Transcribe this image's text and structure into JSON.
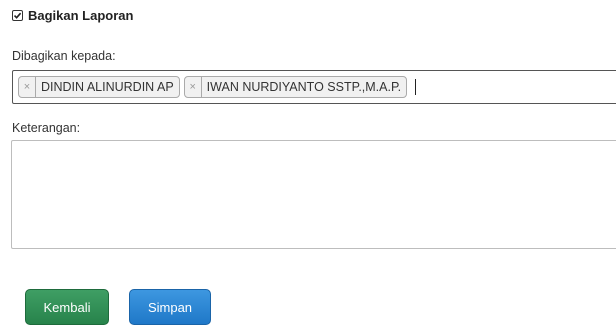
{
  "section": {
    "title": "Bagikan Laporan"
  },
  "shared_with": {
    "label": "Dibagikan kepada:",
    "tags": [
      {
        "remove_glyph": "×",
        "name": "DINDIN ALINURDIN AP"
      },
      {
        "remove_glyph": "×",
        "name": "IWAN NURDIYANTO SSTP.,M.A.P."
      }
    ]
  },
  "notes": {
    "label": "Keterangan:",
    "value": ""
  },
  "buttons": {
    "back_label": "Kembali",
    "save_label": "Simpan"
  },
  "colors": {
    "back_button": "#2e8b57",
    "save_button": "#2a86d4"
  }
}
